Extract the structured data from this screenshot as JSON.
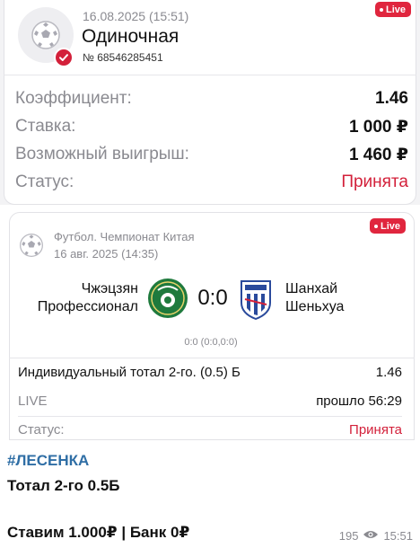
{
  "bet": {
    "datetime": "16.08.2025 (15:51)",
    "type": "Одиночная",
    "number": "№ 68546285451",
    "live_label": "Live",
    "rows": [
      {
        "label": "Коэффициент:",
        "value": "1.46"
      },
      {
        "label": "Ставка:",
        "value": "1 000 ₽"
      },
      {
        "label": "Возможный выигрыш:",
        "value": "1 460 ₽"
      },
      {
        "label": "Статус:",
        "value": "Принята"
      }
    ]
  },
  "event": {
    "league": "Футбол. Чемпионат Китая",
    "date": "16 авг. 2025 (14:35)",
    "live_label": "Live",
    "team_home_line1": "Чжэцзян",
    "team_home_line2": "Профессионал",
    "team_away_line1": "Шанхай",
    "team_away_line2": "Шеньхуа",
    "score": "0:0",
    "subscore": "0:0 (0:0,0:0)",
    "market": "Индивидуальный тотал 2-го. (0.5) Б",
    "odds": "1.46",
    "live_text": "LIVE",
    "elapsed": "прошло 56:29",
    "status_label": "Статус:",
    "status_value": "Принята"
  },
  "message": {
    "hashtag": "#ЛЕСЕНКА",
    "line1": "Тотал 2-го 0.5Б",
    "line2": "Ставим 1.000₽ | Банк 0₽",
    "views": "195",
    "time": "15:51"
  },
  "colors": {
    "accent_red": "#d3203a",
    "hashtag_blue": "#2f6ea5",
    "muted": "#8a8a90"
  },
  "icons": [
    "soccer-ball-icon",
    "check-badge-icon",
    "eye-icon",
    "team-logo-zhejiang",
    "team-logo-shenhua"
  ]
}
